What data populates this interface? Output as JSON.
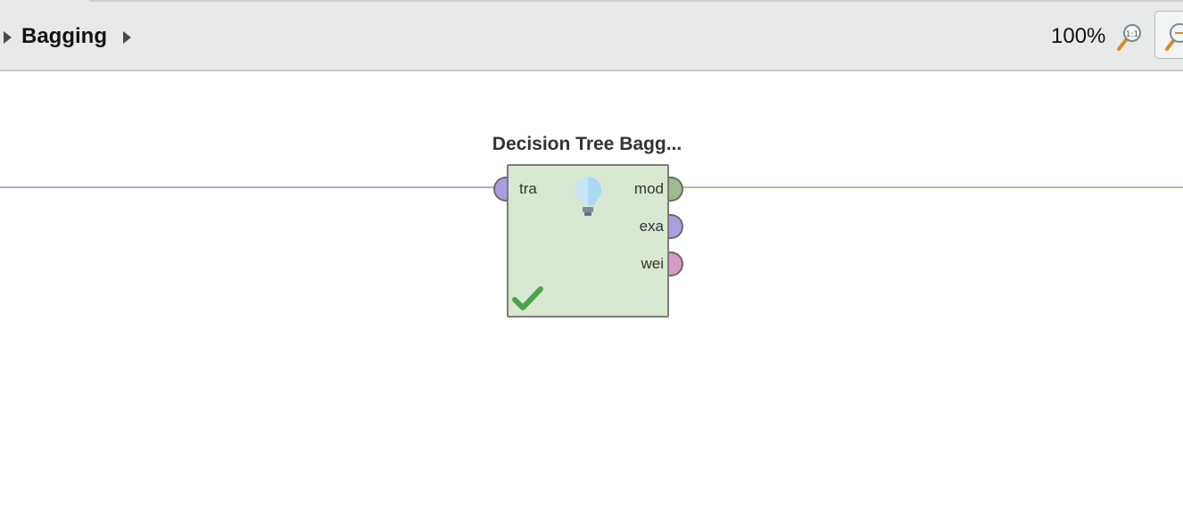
{
  "breadcrumb": {
    "title": "Bagging"
  },
  "zoom": {
    "level": "100%"
  },
  "operator": {
    "name": "Decision Tree Bagg...",
    "input_ports": [
      {
        "label": "tra",
        "color": "#ab9ee0"
      }
    ],
    "output_ports": [
      {
        "label": "mod",
        "color": "#9bbc8c"
      },
      {
        "label": "exa",
        "color": "#ab9ee0"
      },
      {
        "label": "wei",
        "color": "#d59ac5"
      }
    ],
    "status_icon": "checkmark-icon",
    "info_icon": "lightbulb-icon"
  },
  "colors": {
    "operator_fill": "#d9e8d0",
    "input_wire": "#b3a8e0",
    "output_wire": "#a9c69a",
    "toolbar_bg": "#e8eaea"
  }
}
